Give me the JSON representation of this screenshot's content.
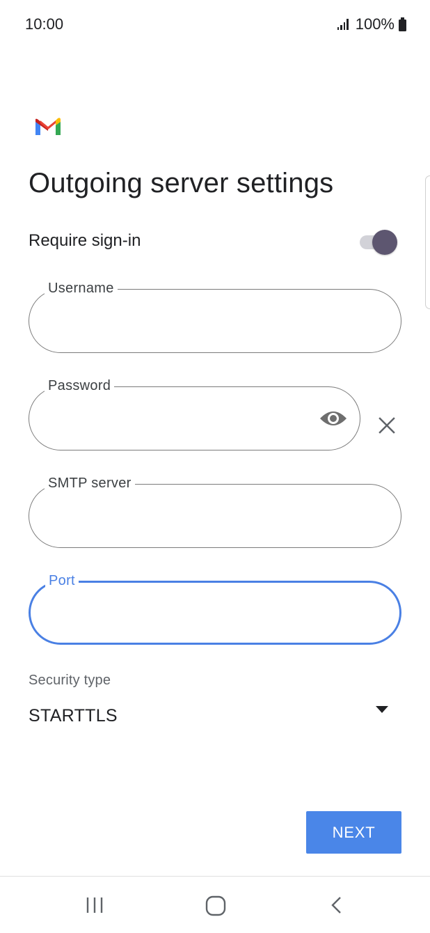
{
  "status_bar": {
    "time": "10:00",
    "battery_percent": "100%",
    "icons": [
      "signal-icon",
      "battery-icon"
    ]
  },
  "app": {
    "logo": "gmail-logo",
    "colors": {
      "red": "#ea4335",
      "blue": "#4285f4",
      "green": "#34a853",
      "yellow": "#fbbc04",
      "accent": "#4a86e8"
    }
  },
  "page": {
    "title": "Outgoing server settings"
  },
  "require_signin": {
    "label": "Require sign-in",
    "enabled": true
  },
  "fields": {
    "username": {
      "label": "Username",
      "value": ""
    },
    "password": {
      "label": "Password",
      "value": "",
      "icons": [
        "eye-icon",
        "close-icon"
      ]
    },
    "smtp_server": {
      "label": "SMTP server",
      "value": ""
    },
    "port": {
      "label": "Port",
      "value": "",
      "focused": true
    }
  },
  "security": {
    "label": "Security type",
    "selected": "STARTTLS",
    "icon": "dropdown-arrow-icon"
  },
  "actions": {
    "next_label": "NEXT"
  },
  "nav_bar": {
    "icons": [
      "recent-apps-icon",
      "home-icon",
      "back-icon"
    ]
  }
}
